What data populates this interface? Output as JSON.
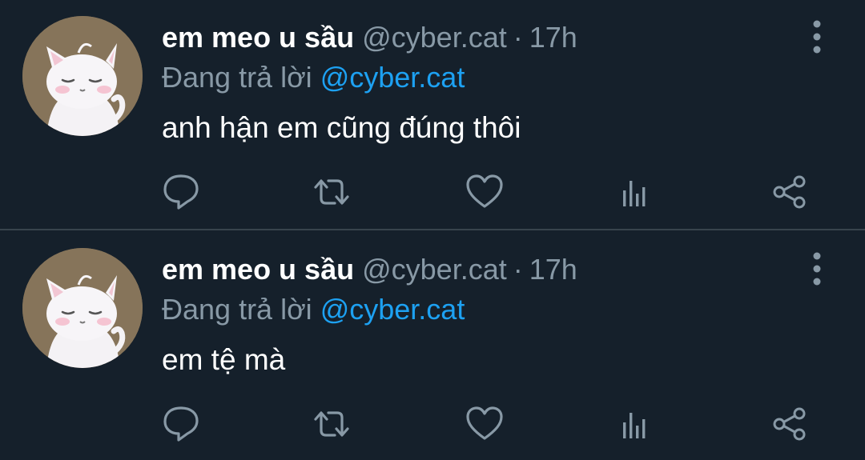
{
  "tweets": [
    {
      "display_name": "em meo u sầu",
      "handle": "@cyber.cat",
      "separator": "·",
      "time": "17h",
      "reply_prefix": "Đang trả lời",
      "reply_to": "@cyber.cat",
      "text": "anh hận em cũng đúng thôi"
    },
    {
      "display_name": "em meo u sầu",
      "handle": "@cyber.cat",
      "separator": "·",
      "time": "17h",
      "reply_prefix": "Đang trả lời",
      "reply_to": "@cyber.cat",
      "text": "em tệ mà"
    }
  ],
  "icons": {
    "more": "vertical-dots-icon",
    "reply": "speech-bubble-icon",
    "retweet": "retweet-arrows-icon",
    "like": "heart-icon",
    "stats": "bar-chart-icon",
    "share": "share-nodes-icon"
  },
  "colors": {
    "background": "#15202b",
    "divider": "#38444d",
    "primary_text": "#ffffff",
    "secondary_text": "#8899a6",
    "link": "#1da1f2"
  }
}
